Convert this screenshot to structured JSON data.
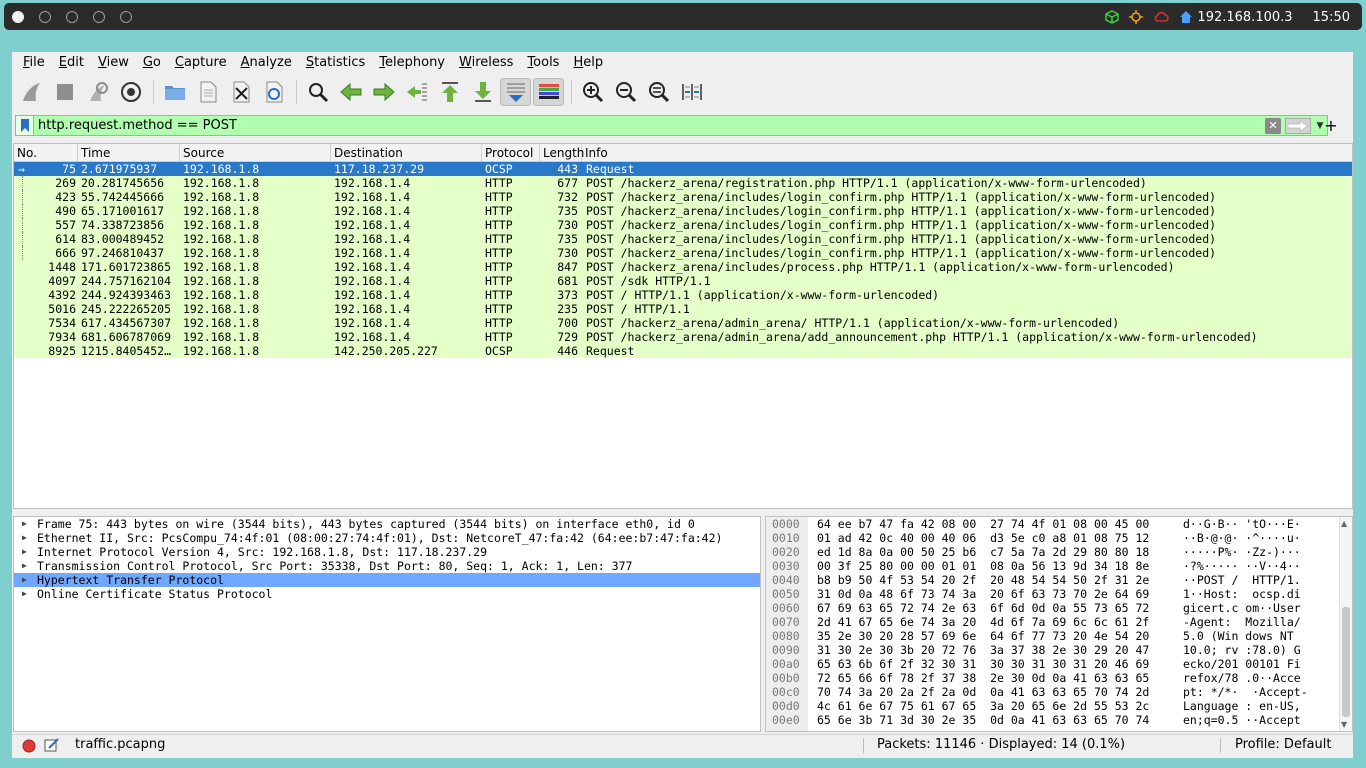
{
  "system": {
    "ip": "192.168.100.3",
    "clock": "15:50",
    "tray_icons": [
      "package-icon",
      "network-icon",
      "cloud-icon",
      "home-icon"
    ]
  },
  "menu": [
    "File",
    "Edit",
    "View",
    "Go",
    "Capture",
    "Analyze",
    "Statistics",
    "Telephony",
    "Wireless",
    "Tools",
    "Help"
  ],
  "filter": {
    "value": "http.request.method == POST"
  },
  "columns": {
    "no": "No.",
    "time": "Time",
    "source": "Source",
    "destination": "Destination",
    "protocol": "Protocol",
    "length": "Length",
    "info": "Info"
  },
  "packets": [
    {
      "no": "75",
      "time": "2.671975937",
      "source": "192.168.1.8",
      "destination": "117.18.237.29",
      "protocol": "OCSP",
      "length": "443",
      "info": "Request"
    },
    {
      "no": "269",
      "time": "20.281745656",
      "source": "192.168.1.8",
      "destination": "192.168.1.4",
      "protocol": "HTTP",
      "length": "677",
      "info": "POST /hackerz_arena/registration.php HTTP/1.1  (application/x-www-form-urlencoded)"
    },
    {
      "no": "423",
      "time": "55.742445666",
      "source": "192.168.1.8",
      "destination": "192.168.1.4",
      "protocol": "HTTP",
      "length": "732",
      "info": "POST /hackerz_arena/includes/login_confirm.php HTTP/1.1  (application/x-www-form-urlencoded)"
    },
    {
      "no": "490",
      "time": "65.171001617",
      "source": "192.168.1.8",
      "destination": "192.168.1.4",
      "protocol": "HTTP",
      "length": "735",
      "info": "POST /hackerz_arena/includes/login_confirm.php HTTP/1.1  (application/x-www-form-urlencoded)"
    },
    {
      "no": "557",
      "time": "74.338723856",
      "source": "192.168.1.8",
      "destination": "192.168.1.4",
      "protocol": "HTTP",
      "length": "730",
      "info": "POST /hackerz_arena/includes/login_confirm.php HTTP/1.1  (application/x-www-form-urlencoded)"
    },
    {
      "no": "614",
      "time": "83.000489452",
      "source": "192.168.1.8",
      "destination": "192.168.1.4",
      "protocol": "HTTP",
      "length": "735",
      "info": "POST /hackerz_arena/includes/login_confirm.php HTTP/1.1  (application/x-www-form-urlencoded)"
    },
    {
      "no": "666",
      "time": "97.246810437",
      "source": "192.168.1.8",
      "destination": "192.168.1.4",
      "protocol": "HTTP",
      "length": "730",
      "info": "POST /hackerz_arena/includes/login_confirm.php HTTP/1.1  (application/x-www-form-urlencoded)"
    },
    {
      "no": "1448",
      "time": "171.601723865",
      "source": "192.168.1.8",
      "destination": "192.168.1.4",
      "protocol": "HTTP",
      "length": "847",
      "info": "POST /hackerz_arena/includes/process.php HTTP/1.1  (application/x-www-form-urlencoded)"
    },
    {
      "no": "4097",
      "time": "244.757162104",
      "source": "192.168.1.8",
      "destination": "192.168.1.4",
      "protocol": "HTTP",
      "length": "681",
      "info": "POST /sdk HTTP/1.1"
    },
    {
      "no": "4392",
      "time": "244.924393463",
      "source": "192.168.1.8",
      "destination": "192.168.1.4",
      "protocol": "HTTP",
      "length": "373",
      "info": "POST / HTTP/1.1  (application/x-www-form-urlencoded)"
    },
    {
      "no": "5016",
      "time": "245.222265205",
      "source": "192.168.1.8",
      "destination": "192.168.1.4",
      "protocol": "HTTP",
      "length": "235",
      "info": "POST / HTTP/1.1"
    },
    {
      "no": "7534",
      "time": "617.434567307",
      "source": "192.168.1.8",
      "destination": "192.168.1.4",
      "protocol": "HTTP",
      "length": "700",
      "info": "POST /hackerz_arena/admin_arena/ HTTP/1.1  (application/x-www-form-urlencoded)"
    },
    {
      "no": "7934",
      "time": "681.606787069",
      "source": "192.168.1.8",
      "destination": "192.168.1.4",
      "protocol": "HTTP",
      "length": "729",
      "info": "POST /hackerz_arena/admin_arena/add_announcement.php HTTP/1.1  (application/x-www-form-urlencoded)"
    },
    {
      "no": "8925",
      "time": "1215.8405452…",
      "source": "192.168.1.8",
      "destination": "142.250.205.227",
      "protocol": "OCSP",
      "length": "446",
      "info": "Request"
    }
  ],
  "details": [
    "Frame 75: 443 bytes on wire (3544 bits), 443 bytes captured (3544 bits) on interface eth0, id 0",
    "Ethernet II, Src: PcsCompu_74:4f:01 (08:00:27:74:4f:01), Dst: NetcoreT_47:fa:42 (64:ee:b7:47:fa:42)",
    "Internet Protocol Version 4, Src: 192.168.1.8, Dst: 117.18.237.29",
    "Transmission Control Protocol, Src Port: 35338, Dst Port: 80, Seq: 1, Ack: 1, Len: 377",
    "Hypertext Transfer Protocol",
    "Online Certificate Status Protocol"
  ],
  "bytes": [
    {
      "off": "0000",
      "hex": "64 ee b7 47 fa 42 08 00  27 74 4f 01 08 00 45 00",
      "ascii": "d··G·B·· 'tO···E·"
    },
    {
      "off": "0010",
      "hex": "01 ad 42 0c 40 00 40 06  d3 5e c0 a8 01 08 75 12",
      "ascii": "··B·@·@· ·^····u·"
    },
    {
      "off": "0020",
      "hex": "ed 1d 8a 0a 00 50 25 b6  c7 5a 7a 2d 29 80 80 18",
      "ascii": "·····P%· ·Zz-)···"
    },
    {
      "off": "0030",
      "hex": "00 3f 25 80 00 00 01 01  08 0a 56 13 9d 34 18 8e",
      "ascii": "·?%····· ··V··4··"
    },
    {
      "off": "0040",
      "hex": "b8 b9 50 4f 53 54 20 2f  20 48 54 54 50 2f 31 2e",
      "ascii": "··POST /  HTTP/1."
    },
    {
      "off": "0050",
      "hex": "31 0d 0a 48 6f 73 74 3a  20 6f 63 73 70 2e 64 69",
      "ascii": "1··Host:  ocsp.di"
    },
    {
      "off": "0060",
      "hex": "67 69 63 65 72 74 2e 63  6f 6d 0d 0a 55 73 65 72",
      "ascii": "gicert.c om··User"
    },
    {
      "off": "0070",
      "hex": "2d 41 67 65 6e 74 3a 20  4d 6f 7a 69 6c 6c 61 2f",
      "ascii": "-Agent:  Mozilla/"
    },
    {
      "off": "0080",
      "hex": "35 2e 30 20 28 57 69 6e  64 6f 77 73 20 4e 54 20",
      "ascii": "5.0 (Win dows NT "
    },
    {
      "off": "0090",
      "hex": "31 30 2e 30 3b 20 72 76  3a 37 38 2e 30 29 20 47",
      "ascii": "10.0; rv :78.0) G"
    },
    {
      "off": "00a0",
      "hex": "65 63 6b 6f 2f 32 30 31  30 30 31 30 31 20 46 69",
      "ascii": "ecko/201 00101 Fi"
    },
    {
      "off": "00b0",
      "hex": "72 65 66 6f 78 2f 37 38  2e 30 0d 0a 41 63 63 65",
      "ascii": "refox/78 .0··Acce"
    },
    {
      "off": "00c0",
      "hex": "70 74 3a 20 2a 2f 2a 0d  0a 41 63 63 65 70 74 2d",
      "ascii": "pt: */*·  ·Accept-"
    },
    {
      "off": "00d0",
      "hex": "4c 61 6e 67 75 61 67 65  3a 20 65 6e 2d 55 53 2c",
      "ascii": "Language : en-US,"
    },
    {
      "off": "00e0",
      "hex": "65 6e 3b 71 3d 30 2e 35  0d 0a 41 63 63 65 70 74",
      "ascii": "en;q=0.5 ··Accept"
    }
  ],
  "status": {
    "file": "traffic.pcapng",
    "packets": "Packets: 11146 · Displayed: 14 (0.1%)",
    "profile": "Profile: Default"
  },
  "colors": {
    "selected_row": "#2a79c8",
    "http_row": "#e4ffc7",
    "filter_ok": "#afffaf",
    "detail_highlight": "#72a7ff"
  }
}
